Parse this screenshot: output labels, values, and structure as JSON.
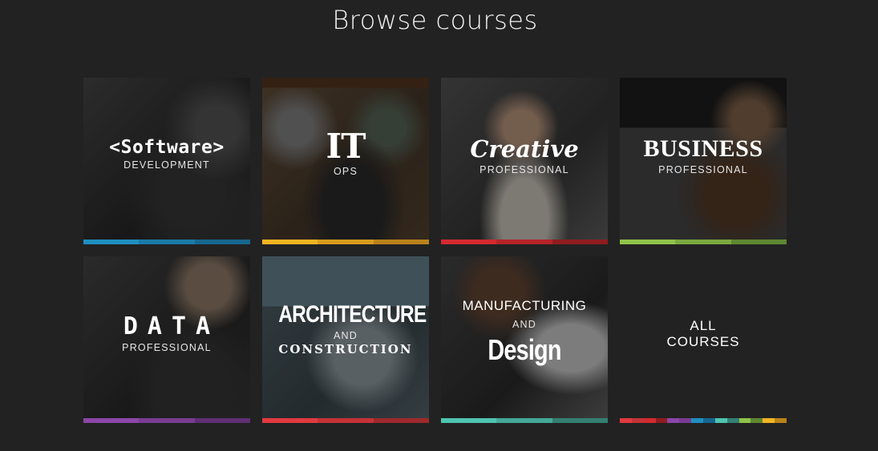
{
  "page": {
    "title": "Browse courses"
  },
  "tiles": [
    {
      "main": "<Software>",
      "sub": "DEVELOPMENT",
      "bar": [
        "#1f8fc0",
        "#1a7aa8",
        "#16678f"
      ]
    },
    {
      "main": "IT",
      "sub": "OPS",
      "bar": [
        "#f3b422",
        "#d79b1d",
        "#b9821a"
      ]
    },
    {
      "main": "Creative",
      "sub": "PROFESSIONAL",
      "bar": [
        "#d22a2f",
        "#b52428",
        "#8f1c20"
      ]
    },
    {
      "main": "BUSINESS",
      "sub": "PROFESSIONAL",
      "bar": [
        "#8fc24a",
        "#7aa83e",
        "#5f8732"
      ]
    },
    {
      "main": "DATA",
      "sub": "PROFESSIONAL",
      "bar": [
        "#8c46a8",
        "#7a3c93",
        "#5f2f74"
      ]
    },
    {
      "main": "ARCHITECTURE",
      "mid": "AND",
      "main2": "CONSTRUCTION",
      "bar": [
        "#e13a3f",
        "#c43237",
        "#9e292d"
      ]
    },
    {
      "top": "MANUFACTURING",
      "mid": "AND",
      "main": "Design",
      "bar": [
        "#4fc4b0",
        "#43a898",
        "#347f73"
      ]
    },
    {
      "line1": "ALL",
      "line2": "COURSES",
      "bar": [
        "#e13a3f",
        "#c43237",
        "#d22a2f",
        "#8f1c20",
        "#8c46a8",
        "#7a3c93",
        "#1f8fc0",
        "#16678f",
        "#4fc4b0",
        "#347f73",
        "#8fc24a",
        "#5f8732",
        "#f3b422",
        "#b9821a"
      ]
    }
  ]
}
